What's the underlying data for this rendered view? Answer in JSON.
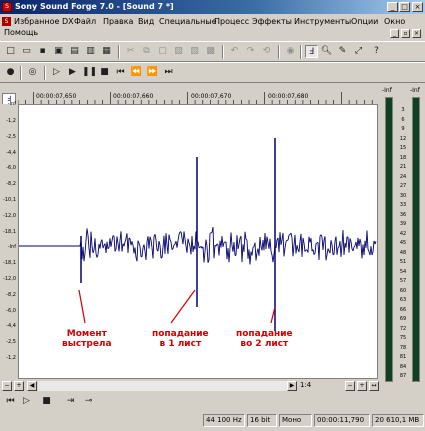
{
  "window": {
    "title": "Sony Sound Forge 7.0 - [Sound 7 *]",
    "min": "_",
    "max": "□",
    "close": "×"
  },
  "menu": {
    "items": [
      "Избранное DX",
      "Файл",
      "Правка",
      "Вид",
      "Специальные",
      "Процесс",
      "Эффекты",
      "Инструменты",
      "Опции",
      "Окно"
    ],
    "help": "Помощь"
  },
  "timeline": {
    "labels": [
      "00:00:07,650",
      "00:00:07,660",
      "00:00:07,670",
      "00:00:07,680"
    ]
  },
  "yaxis": {
    "top_label": "-Inf",
    "ticks": [
      "-1,2",
      "-2,5",
      "-4,4",
      "-6,0",
      "-8,2",
      "-10,1",
      "-12,0",
      "-18,1",
      "-Inf",
      "-18,1",
      "-12,0",
      "-8,2",
      "-6,0",
      "-4,4",
      "-2,5",
      "-1,2"
    ]
  },
  "vu": {
    "top_left": "-Inf",
    "top_right": "-Inf",
    "ticks": [
      "3",
      "6",
      "9",
      "12",
      "15",
      "18",
      "21",
      "24",
      "27",
      "30",
      "33",
      "36",
      "39",
      "42",
      "45",
      "48",
      "51",
      "54",
      "57",
      "60",
      "63",
      "66",
      "69",
      "72",
      "75",
      "78",
      "81",
      "84",
      "87"
    ]
  },
  "annotations": {
    "shot": "Момент\nвыстрела",
    "hit1": "попадание\nв 1 лист",
    "hit2": "попадание\nво 2 лист"
  },
  "scroll": {
    "zoom": "1:4"
  },
  "status": {
    "sample_rate": "44 100 Hz",
    "bit_depth": "16 bit",
    "channels": "Моно",
    "position": "00:00:11,790",
    "disk_space": "20 610,1 MB"
  },
  "transport": {
    "time": "00:00:11,790"
  },
  "colors": {
    "waveform": "#000070",
    "annotation": "#d00000",
    "title_start": "#0a246a"
  }
}
